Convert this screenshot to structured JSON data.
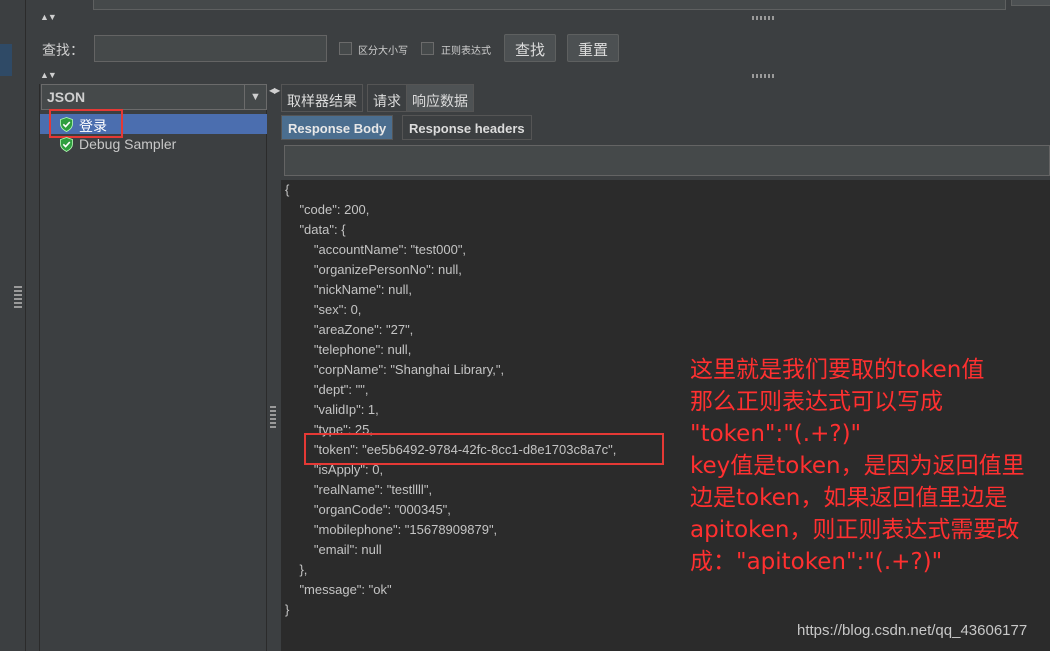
{
  "search": {
    "label": "查找：",
    "value": "",
    "case_label": "区分大小写",
    "regex_label": "正则表达式",
    "find_button": "查找",
    "reset_button": "重置"
  },
  "tree": {
    "renderer": "JSON",
    "items": [
      {
        "label": "登录",
        "status": "success"
      },
      {
        "label": "Debug Sampler",
        "status": "success"
      }
    ]
  },
  "tabs": [
    "取样器结果",
    "请求",
    "响应数据"
  ],
  "subtabs": [
    "Response Body",
    "Response headers"
  ],
  "response_lines": [
    "{",
    "    \"code\": 200,",
    "    \"data\": {",
    "        \"accountName\": \"test000\",",
    "        \"organizePersonNo\": null,",
    "        \"nickName\": null,",
    "        \"sex\": 0,",
    "        \"areaZone\": \"27\",",
    "        \"telephone\": null,",
    "        \"corpName\": \"Shanghai Library,\",",
    "        \"dept\": \"\",",
    "        \"validIp\": 1,",
    "        \"type\": 25,",
    "        \"token\": \"ee5b6492-9784-42fc-8cc1-d8e1703c8a7c\",",
    "        \"isApply\": 0,",
    "        \"realName\": \"testllll\",",
    "        \"organCode\": \"000345\",",
    "        \"mobilephone\": \"15678909879\",",
    "        \"email\": null",
    "    },",
    "    \"message\": \"ok\"",
    "}"
  ],
  "annotation": [
    "这里就是我们要取的token值",
    "那么正则表达式可以写成",
    "\"token\":\"(.+?)\"",
    "key值是token，是因为返回值里",
    "边是token，如果返回值里边是",
    "apitoken，则正则表达式需要改",
    "成：\"apitoken\":\"(.+?)\""
  ],
  "watermark": "https://blog.csdn.net/qq_43606177",
  "colors": {
    "background": "#3c3f41",
    "selection": "#4b6eaf",
    "annotation_red": "#ff3030",
    "success_green": "#2e9e3e"
  }
}
